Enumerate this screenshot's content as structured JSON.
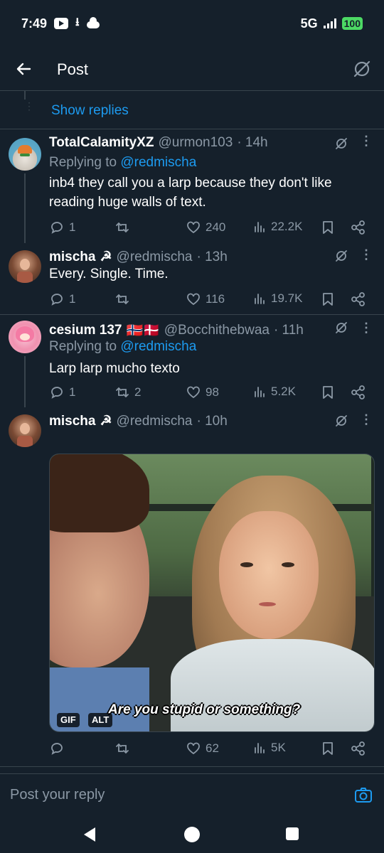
{
  "status_bar": {
    "time": "7:49",
    "network": "5G",
    "battery": "100"
  },
  "header": {
    "title": "Post"
  },
  "show_replies": {
    "label": "Show replies"
  },
  "tweets": [
    {
      "name": "TotalCalamityXZ",
      "handle": "@urmon103",
      "time": "· 14h",
      "replying_prefix": "Replying to",
      "replying_to": "@redmischa",
      "text": "inb4 they call you a larp because they don't like reading huge walls of text.",
      "replies": "1",
      "reposts": "",
      "likes": "240",
      "views": "22.2K"
    },
    {
      "name": "mischa",
      "name_emoji": "☭",
      "handle": "@redmischa",
      "time": "· 13h",
      "text": "Every. Single. Time.",
      "replies": "1",
      "reposts": "",
      "likes": "116",
      "views": "19.7K"
    },
    {
      "name": "cesium 137",
      "name_emoji": "🇳🇴🇩🇰",
      "handle": "@Bocchithebwaa",
      "time": "· 11h",
      "replying_prefix": "Replying to",
      "replying_to": "@redmischa",
      "text": "Larp larp mucho texto",
      "replies": "1",
      "reposts": "2",
      "likes": "98",
      "views": "5.2K"
    },
    {
      "name": "mischa",
      "name_emoji": "☭",
      "handle": "@redmischa",
      "time": "· 10h",
      "media_caption": "Are you stupid or something?",
      "media_badge_gif": "GIF",
      "media_badge_alt": "ALT",
      "replies": "",
      "reposts": "",
      "likes": "62",
      "views": "5K"
    }
  ],
  "reply_bar": {
    "placeholder": "Post your reply"
  },
  "colors": {
    "background": "#15202b",
    "accent": "#1d9bf0",
    "secondary_text": "#8b98a5",
    "divider": "#38444d"
  },
  "icons": [
    "back-arrow-icon",
    "grok-icon",
    "more-icon",
    "reply-icon",
    "repost-icon",
    "like-icon",
    "views-icon",
    "bookmark-icon",
    "share-icon",
    "camera-icon"
  ]
}
